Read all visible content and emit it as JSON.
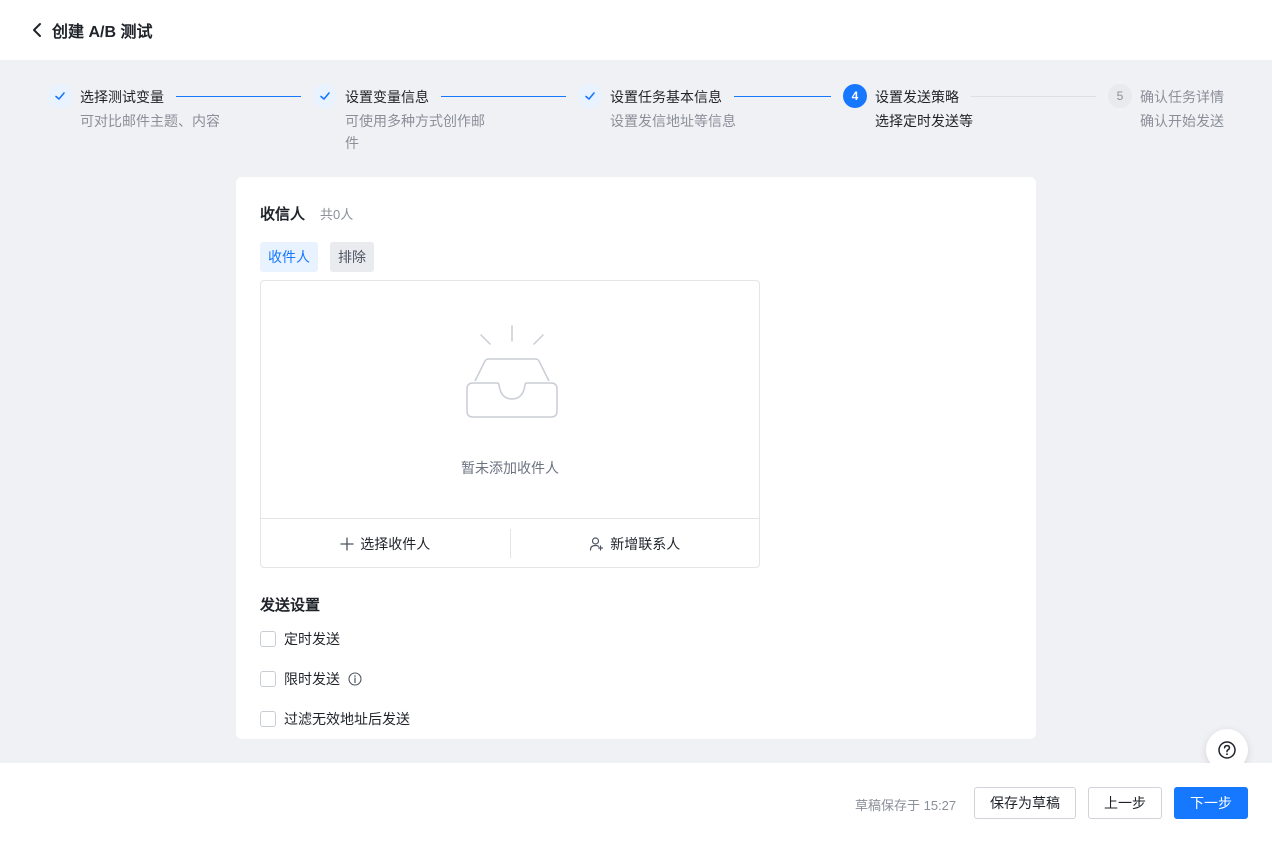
{
  "header": {
    "back_icon": "chevron-left-icon",
    "title": "创建 A/B 测试"
  },
  "steps": [
    {
      "title": "选择测试变量",
      "desc": "可对比邮件主题、内容",
      "status": "done",
      "icon": "check-icon"
    },
    {
      "title": "设置变量信息",
      "desc_line1": "可使用多种方式创作邮",
      "desc_line2": "件",
      "status": "done",
      "icon": "check-icon"
    },
    {
      "title": "设置任务基本信息",
      "desc": "设置发信地址等信息",
      "status": "done",
      "icon": "check-icon"
    },
    {
      "number": "4",
      "title": "设置发送策略",
      "desc": "选择定时发送等",
      "status": "active"
    },
    {
      "number": "5",
      "title": "确认任务详情",
      "desc": "确认开始发送",
      "status": "pending"
    }
  ],
  "recipients": {
    "title": "收信人",
    "count": "共0人",
    "tabs": [
      "收件人",
      "排除"
    ],
    "empty_icon": "empty-inbox-icon",
    "empty_text": "暂未添加收件人",
    "select_label": "选择收件人",
    "select_icon": "plus-icon",
    "add_contact_label": "新增联系人",
    "add_contact_icon": "add-user-icon"
  },
  "send_settings": {
    "title": "发送设置",
    "options": [
      {
        "label": "定时发送",
        "checked": false
      },
      {
        "label": "限时发送",
        "checked": false,
        "info_icon": "info-icon"
      },
      {
        "label": "过滤无效地址后发送",
        "checked": false
      }
    ]
  },
  "help": {
    "icon": "help-circle-icon"
  },
  "footer": {
    "draft_status": "草稿保存于 15:27",
    "save_draft": "保存为草稿",
    "prev": "上一步",
    "next": "下一步"
  },
  "colors": {
    "primary": "#1677ff",
    "primary_light": "#e8f3ff",
    "background": "#f0f1f4"
  }
}
